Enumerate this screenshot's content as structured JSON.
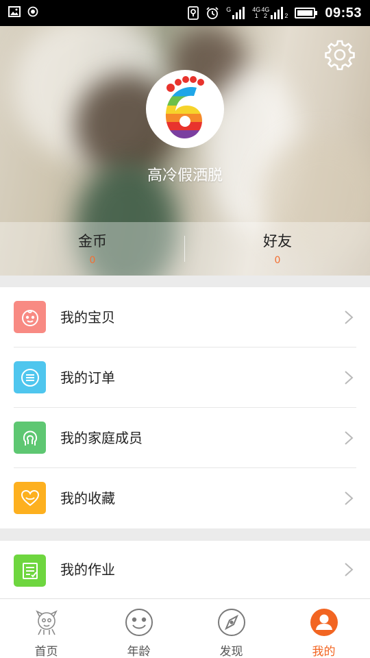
{
  "status_bar": {
    "network_top": "4G",
    "network_bottom": "1",
    "network_top2": "4G",
    "network_bottom2": "2",
    "sim_top": "G",
    "sim2_suffix": "2",
    "time": "09:53"
  },
  "profile": {
    "username": "高冷假洒脱",
    "stats": [
      {
        "label": "金币",
        "value": "0"
      },
      {
        "label": "好友",
        "value": "0"
      }
    ]
  },
  "menu_group_1": [
    {
      "label": "我的宝贝",
      "icon": "baby-face-icon",
      "color": "#f88a83"
    },
    {
      "label": "我的订单",
      "icon": "order-list-icon",
      "color": "#4fc6ee"
    },
    {
      "label": "我的家庭成员",
      "icon": "family-icon",
      "color": "#5ec772"
    },
    {
      "label": "我的收藏",
      "icon": "heart-icon",
      "color": "#fdb01f"
    }
  ],
  "menu_group_2": [
    {
      "label": "我的作业",
      "icon": "homework-icon",
      "color": "#6ed63f"
    }
  ],
  "bottom_nav": [
    {
      "label": "首页",
      "icon": "home-mascot-icon",
      "active": false
    },
    {
      "label": "年龄",
      "icon": "smiley-face-icon",
      "active": false
    },
    {
      "label": "发现",
      "icon": "compass-icon",
      "active": false
    },
    {
      "label": "我的",
      "icon": "user-icon",
      "active": true
    }
  ],
  "colors": {
    "accent": "#f26522",
    "stat_value": "#f36f32"
  }
}
